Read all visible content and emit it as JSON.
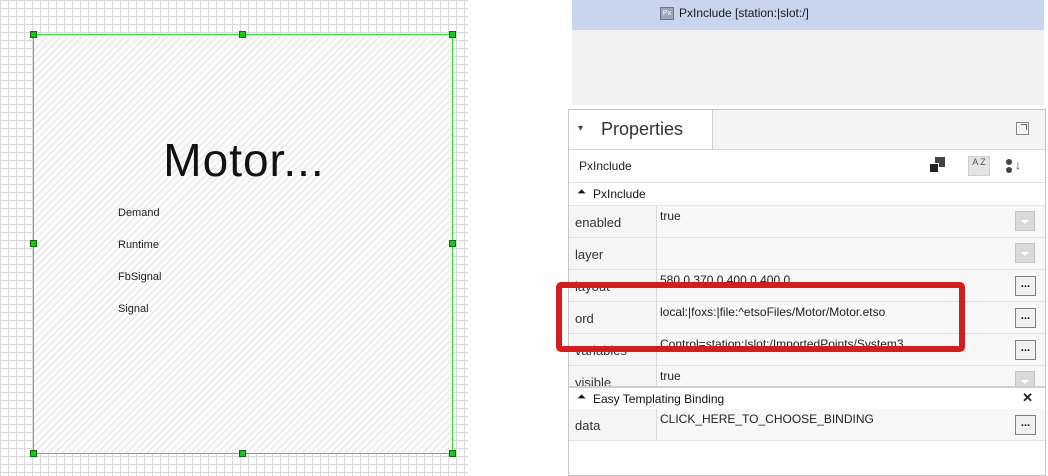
{
  "canvas": {
    "motor_title": "Motor...",
    "signals": [
      "Demand",
      "Runtime",
      "FbSignal",
      "Signal"
    ]
  },
  "nav": {
    "badge": "Px",
    "selected_item": "PxInclude [station:|slot:/]"
  },
  "properties": {
    "tab_title": "Properties",
    "object_type": "PxInclude",
    "section1": "PxInclude",
    "rows": [
      {
        "name": "enabled",
        "value": "true",
        "control": "dropdown"
      },
      {
        "name": "layer",
        "value": "",
        "control": "dropdown"
      },
      {
        "name": "layout",
        "value": "580.0,370.0,400.0,400.0",
        "control": "ellipsis"
      },
      {
        "name": "ord",
        "value": "local:|foxs:|file:^etsoFiles/Motor/Motor.etso",
        "control": "ellipsis"
      },
      {
        "name": "variables",
        "value": "Control=station:|slot:/ImportedPoints/System3",
        "control": "ellipsis"
      },
      {
        "name": "visible",
        "value": "true",
        "control": "dropdown"
      }
    ],
    "section2": "Easy Templating Binding",
    "binding_row": {
      "name": "data",
      "value": "CLICK_HERE_TO_CHOOSE_BINDING",
      "control": "ellipsis"
    },
    "ellipsis_label": "...",
    "sort_label": "A Z"
  },
  "colors": {
    "highlight": "#d21e1e",
    "selection_bar": "#c7d6ee",
    "frame_border": "#33dd33"
  }
}
